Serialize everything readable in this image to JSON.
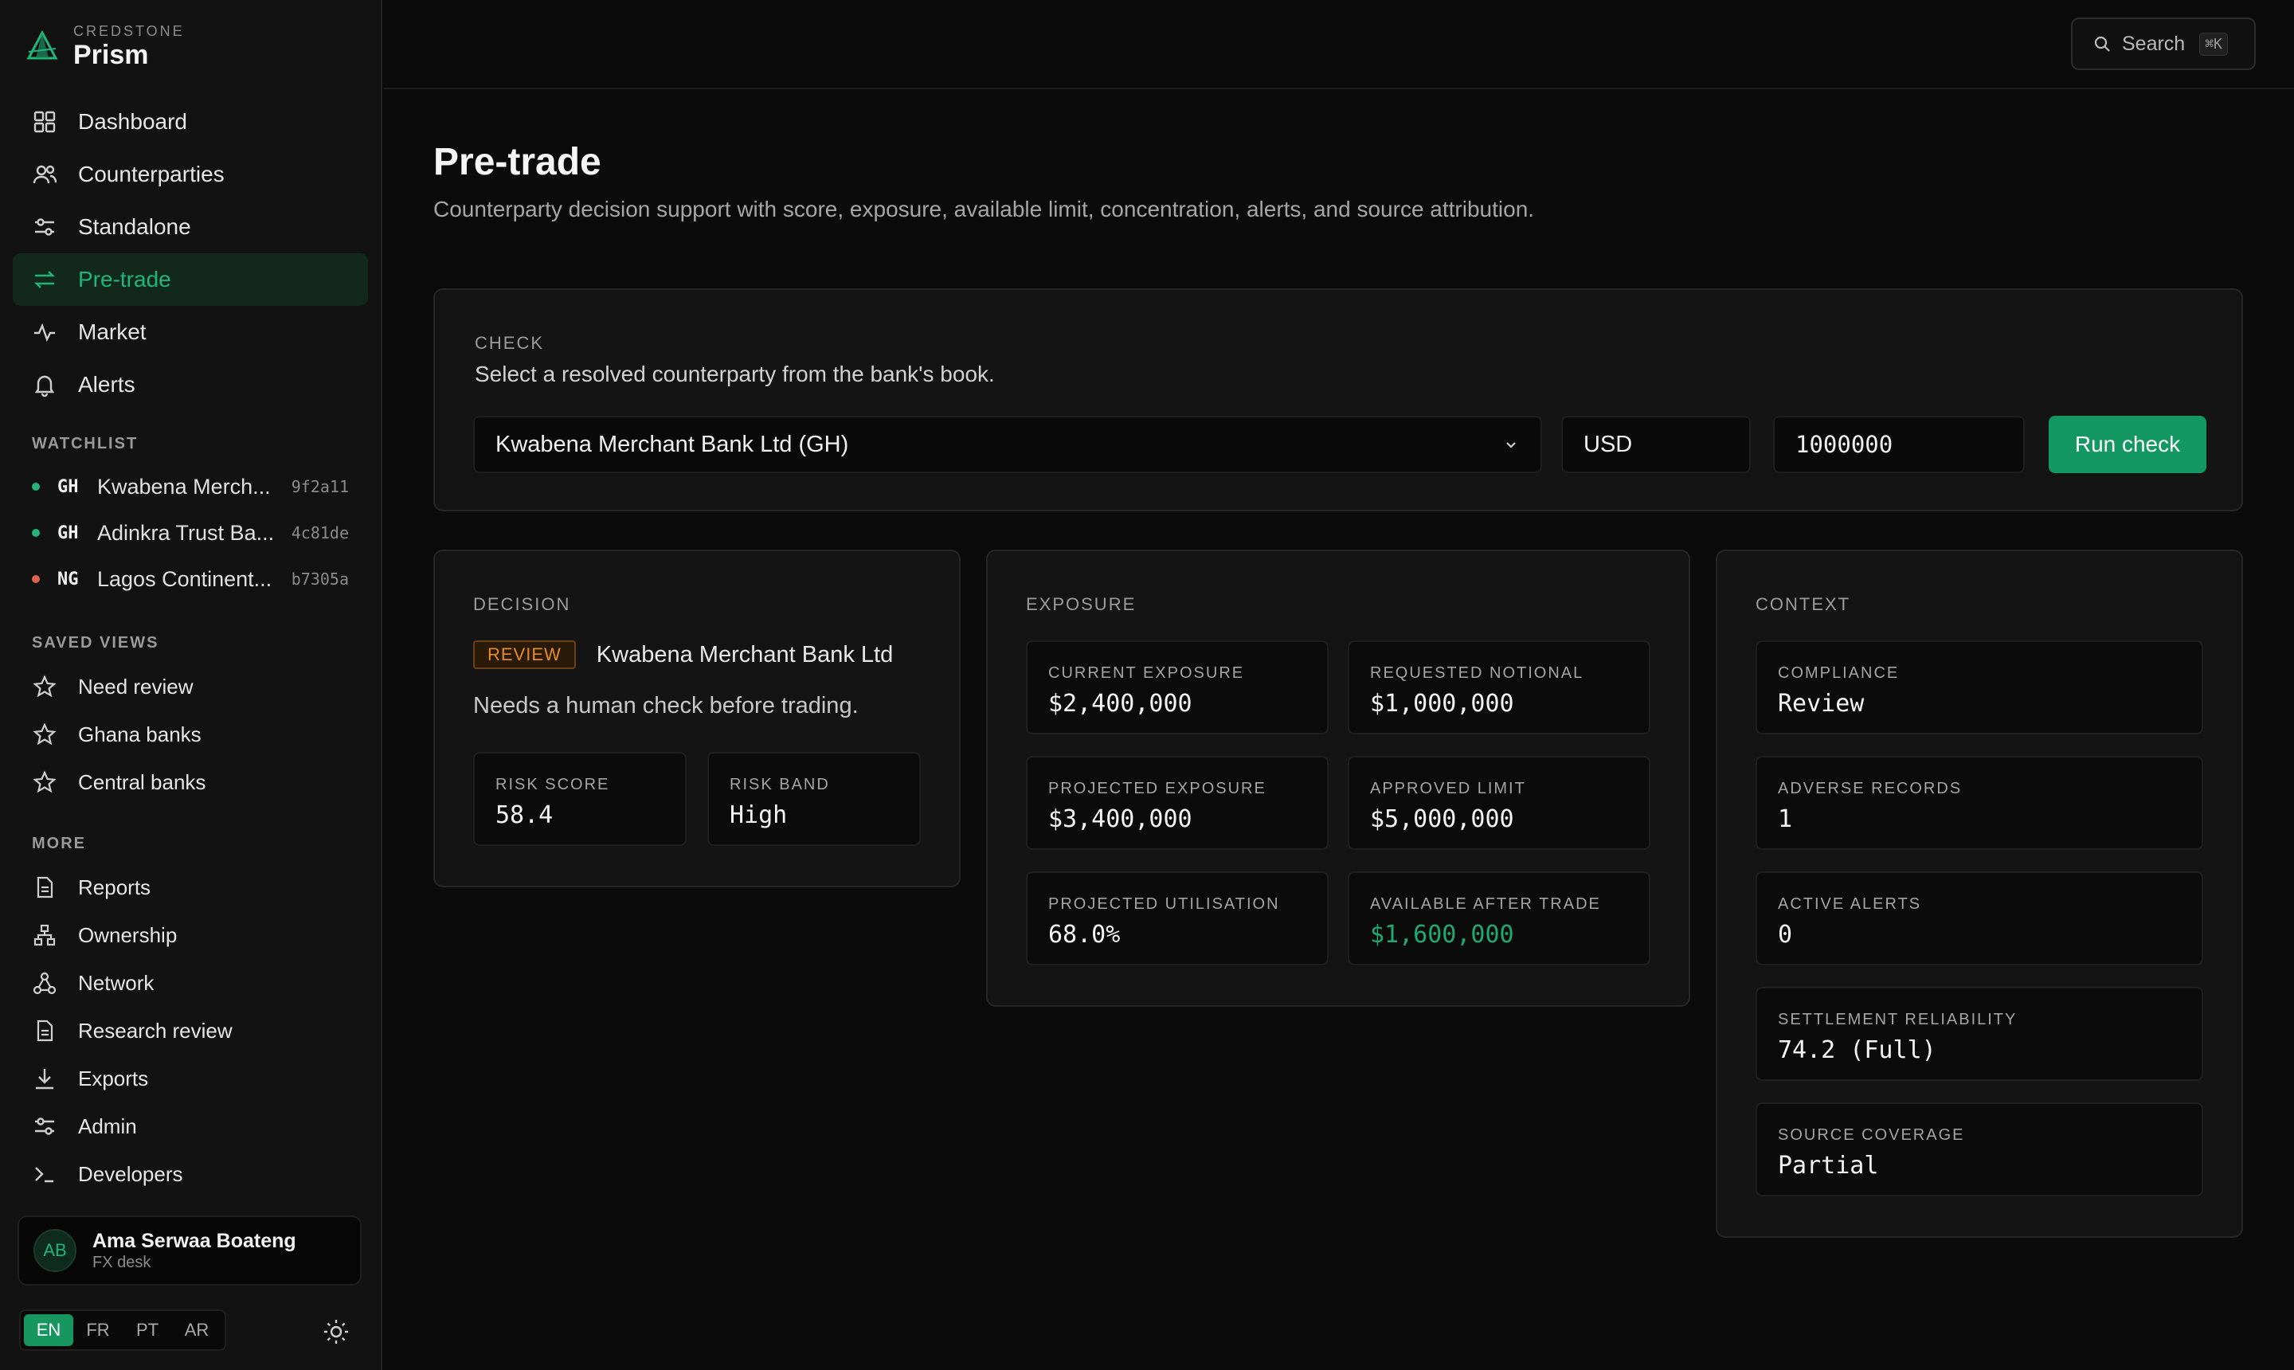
{
  "brand": {
    "kicker": "CREDSTONE",
    "name": "Prism",
    "accent": "#21b57a"
  },
  "nav": {
    "items": [
      {
        "label": "Dashboard",
        "icon": "grid-icon"
      },
      {
        "label": "Counterparties",
        "icon": "users-icon"
      },
      {
        "label": "Standalone",
        "icon": "sliders-icon"
      },
      {
        "label": "Pre-trade",
        "icon": "swap-icon",
        "active": true
      },
      {
        "label": "Market",
        "icon": "pulse-icon"
      },
      {
        "label": "Alerts",
        "icon": "bell-icon"
      }
    ]
  },
  "watchlist": {
    "label": "WATCHLIST",
    "items": [
      {
        "country": "GH",
        "name": "Kwabena Merch...",
        "id": "9f2a11",
        "status_color": "#21b57a"
      },
      {
        "country": "GH",
        "name": "Adinkra Trust Ba...",
        "id": "4c81de",
        "status_color": "#21b57a"
      },
      {
        "country": "NG",
        "name": "Lagos Continent...",
        "id": "b7305a",
        "status_color": "#e0624e"
      }
    ]
  },
  "saved_views": {
    "label": "SAVED VIEWS",
    "items": [
      {
        "label": "Need review",
        "icon": "star-icon"
      },
      {
        "label": "Ghana banks",
        "icon": "star-icon"
      },
      {
        "label": "Central banks",
        "icon": "star-icon"
      }
    ]
  },
  "more": {
    "label": "MORE",
    "items": [
      {
        "label": "Reports",
        "icon": "document-icon"
      },
      {
        "label": "Ownership",
        "icon": "hierarchy-icon"
      },
      {
        "label": "Network",
        "icon": "network-icon"
      },
      {
        "label": "Research review",
        "icon": "document-icon"
      },
      {
        "label": "Exports",
        "icon": "download-icon"
      },
      {
        "label": "Admin",
        "icon": "sliders-icon"
      },
      {
        "label": "Developers",
        "icon": "terminal-icon"
      }
    ]
  },
  "user": {
    "initials": "AB",
    "name": "Ama Serwaa Boateng",
    "role": "FX desk"
  },
  "languages": [
    "EN",
    "FR",
    "PT",
    "AR"
  ],
  "active_language": "EN",
  "search": {
    "label": "Search",
    "shortcut": "⌘K"
  },
  "page": {
    "title": "Pre-trade",
    "subtitle": "Counterparty decision support with score, exposure, available limit, concentration, alerts, and source attribution."
  },
  "check": {
    "label": "CHECK",
    "hint": "Select a resolved counterparty from the bank's book.",
    "counterparty": "Kwabena Merchant Bank Ltd (GH)",
    "currency": "USD",
    "amount": "1000000",
    "run_label": "Run check"
  },
  "decision": {
    "label": "DECISION",
    "badge": "REVIEW",
    "counterparty": "Kwabena Merchant Bank Ltd",
    "text": "Needs a human check before trading.",
    "risk_score_label": "RISK SCORE",
    "risk_score": "58.4",
    "risk_band_label": "RISK BAND",
    "risk_band": "High"
  },
  "exposure": {
    "label": "EXPOSURE",
    "current_label": "CURRENT EXPOSURE",
    "current": "$2,400,000",
    "requested_label": "REQUESTED NOTIONAL",
    "requested": "$1,000,000",
    "projected_label": "PROJECTED EXPOSURE",
    "projected": "$3,400,000",
    "limit_label": "APPROVED LIMIT",
    "limit": "$5,000,000",
    "utilisation_label": "PROJECTED UTILISATION",
    "utilisation": "68.0%",
    "available_label": "AVAILABLE AFTER TRADE",
    "available": "$1,600,000"
  },
  "context": {
    "label": "CONTEXT",
    "compliance_label": "COMPLIANCE",
    "compliance": "Review",
    "adverse_label": "ADVERSE RECORDS",
    "adverse": "1",
    "alerts_label": "ACTIVE ALERTS",
    "alerts": "0",
    "settlement_label": "SETTLEMENT RELIABILITY",
    "settlement": "74.2 (Full)",
    "coverage_label": "SOURCE COVERAGE",
    "coverage": "Partial"
  }
}
